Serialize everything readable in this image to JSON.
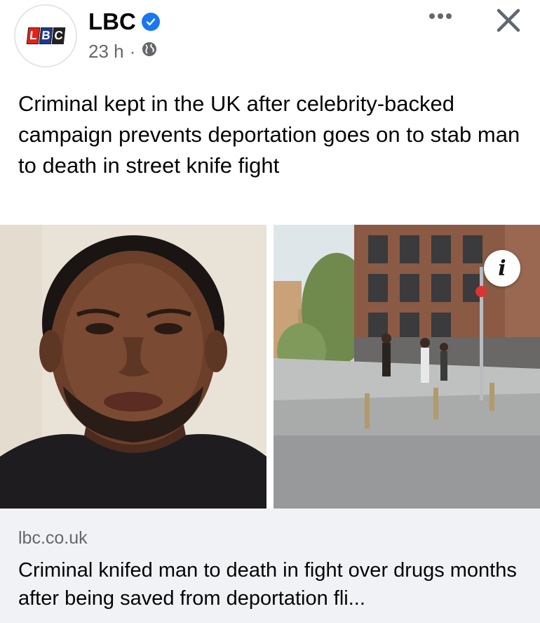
{
  "header": {
    "page_name": "LBC",
    "logo_letters": [
      "L",
      "B",
      "C"
    ],
    "timestamp": "23 h",
    "separator": "·",
    "audience_icon": "globe-icon",
    "verified_icon": "verified-badge-icon",
    "more_icon": "more-options-icon",
    "close_icon": "close-icon"
  },
  "post": {
    "text": "Criminal kept in the UK after celebrity-backed campaign prevents deportation goes on to stab man to death in street knife fight"
  },
  "media": {
    "info_label": "i"
  },
  "link_preview": {
    "domain": "lbc.co.uk",
    "title": "Criminal knifed man to death in fight over drugs months after being saved from deportation fli..."
  },
  "colors": {
    "verified_blue": "#1877f2",
    "secondary_text": "#65676b",
    "link_card_bg": "#f0f2f5",
    "logo_red": "#e2231a",
    "logo_blue": "#1f3a8a"
  }
}
